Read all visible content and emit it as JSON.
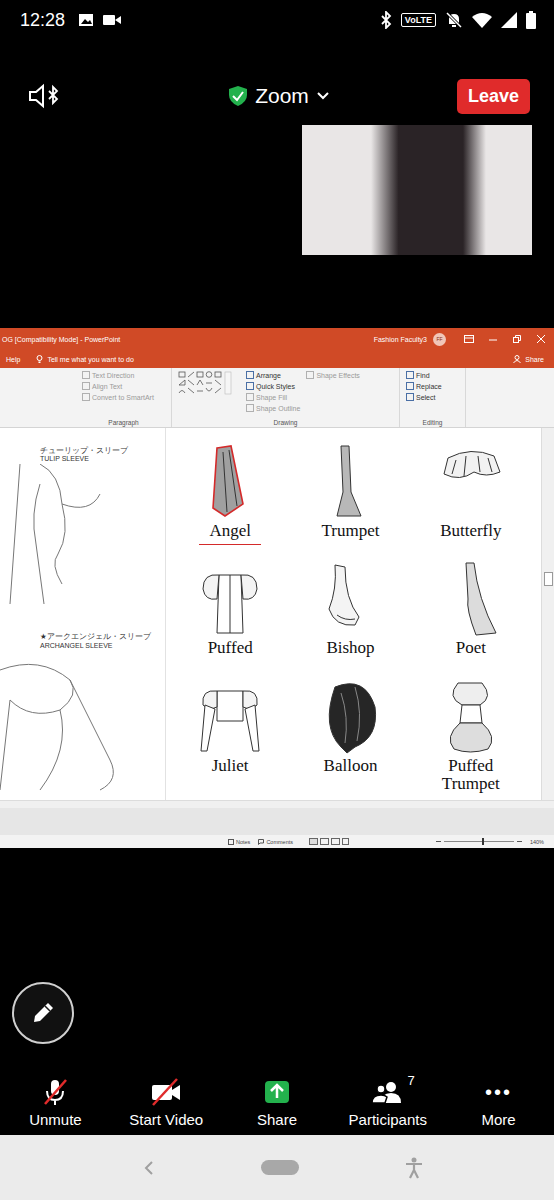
{
  "status_bar": {
    "time": "12:28",
    "network": "VoLTE"
  },
  "meeting_bar": {
    "title": "Zoom",
    "leave": "Leave"
  },
  "shared_screen": {
    "title_bar": {
      "document": "OG [Compatibility Mode] - PowerPoint",
      "user": "Fashion Faculty3",
      "avatar": "FF"
    },
    "menu": {
      "items": [
        "Help"
      ],
      "tell_me": "Tell me what you want to do",
      "share": "Share"
    },
    "ribbon": [
      {
        "label": "Paragraph",
        "commands": [
          {
            "label": "Text Direction",
            "disabled": true
          },
          {
            "label": "Align Text",
            "disabled": true
          },
          {
            "label": "Convert to SmartArt",
            "disabled": true
          }
        ]
      },
      {
        "label": "Drawing",
        "commands": [
          {
            "label": "Arrange",
            "disabled": false
          },
          {
            "label": "Quick Styles",
            "disabled": false
          },
          {
            "label": "Shape Fill",
            "disabled": true
          },
          {
            "label": "Shape Outline",
            "disabled": true
          },
          {
            "label": "Shape Effects",
            "disabled": true
          }
        ]
      },
      {
        "label": "Editing",
        "commands": [
          {
            "label": "Find",
            "disabled": false
          },
          {
            "label": "Replace",
            "disabled": false
          },
          {
            "label": "Select",
            "disabled": false
          }
        ]
      }
    ],
    "slide": {
      "side_labels": [
        {
          "japanese": "チューリップ・スリーブ",
          "english": "TULIP SLEEVE"
        },
        {
          "japanese": "★アークエンジェル・スリーブ",
          "english": "ARCHANGEL SLEEVE"
        }
      ],
      "sleeves": [
        {
          "name": "Angel",
          "kind": "angel",
          "annotated": true
        },
        {
          "name": "Trumpet",
          "kind": "trumpet",
          "annotated": false
        },
        {
          "name": "Butterfly",
          "kind": "butterfly",
          "annotated": false
        },
        {
          "name": "Puffed",
          "kind": "puffed",
          "annotated": false
        },
        {
          "name": "Bishop",
          "kind": "bishop",
          "annotated": false
        },
        {
          "name": "Poet",
          "kind": "poet",
          "annotated": false
        },
        {
          "name": "Juliet",
          "kind": "juliet",
          "annotated": false
        },
        {
          "name": "Balloon",
          "kind": "balloon",
          "annotated": false
        },
        {
          "name": "Puffed Trumpet",
          "kind": "puffedtrumpet",
          "annotated": false
        }
      ]
    },
    "status": {
      "notes": "Notes",
      "comments": "Comments",
      "zoom": "140%",
      "level": 0.55
    }
  },
  "toolbar": [
    {
      "label": "Unmute",
      "kind": "mic",
      "off": true
    },
    {
      "label": "Start Video",
      "kind": "video",
      "off": true
    },
    {
      "label": "Share",
      "kind": "share",
      "off": false
    },
    {
      "label": "Participants",
      "kind": "participants",
      "off": false,
      "count": "7"
    },
    {
      "label": "More",
      "kind": "more",
      "off": false,
      "glyph": "•••"
    }
  ]
}
